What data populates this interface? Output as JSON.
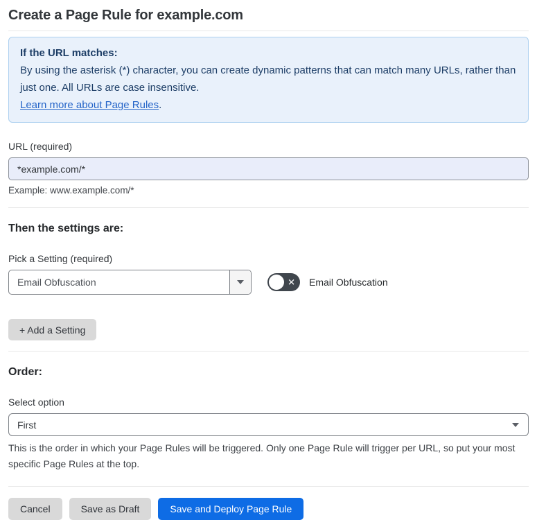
{
  "page": {
    "title": "Create a Page Rule for example.com"
  },
  "info_box": {
    "heading": "If the URL matches:",
    "body": "By using the asterisk (*) character, you can create dynamic patterns that can match many URLs, rather than just one. All URLs are case insensitive.",
    "link_label": "Learn more about Page Rules",
    "link_suffix": "."
  },
  "url_section": {
    "label": "URL (required)",
    "input_value": "*example.com/*",
    "helper": "Example: www.example.com/*"
  },
  "settings_section": {
    "heading": "Then the settings are:",
    "pick_label": "Pick a Setting (required)",
    "dropdown_value": "Email Obfuscation",
    "toggle_label": "Email Obfuscation",
    "toggle_state": "off",
    "add_setting_label": "+ Add a Setting"
  },
  "order_section": {
    "heading": "Order:",
    "select_label": "Select option",
    "select_value": "First",
    "helper": "This is the order in which your Page Rules will be triggered. Only one Page Rule will trigger per URL, so put your most specific Page Rules at the top."
  },
  "footer": {
    "cancel_label": "Cancel",
    "save_draft_label": "Save as Draft",
    "save_deploy_label": "Save and Deploy Page Rule"
  },
  "icons": {
    "caret_down": "caret-down",
    "toggle_x": "✕"
  },
  "colors": {
    "accent_blue": "#0e6ce5",
    "info_box_bg": "#e9f1fb",
    "info_box_border": "#abcfef",
    "info_text_navy": "#1c3d66",
    "link_blue": "#2464c8",
    "url_input_bg": "#e9edfa",
    "button_gray": "#d9d9d9",
    "toggle_off_bg": "#40464d"
  }
}
